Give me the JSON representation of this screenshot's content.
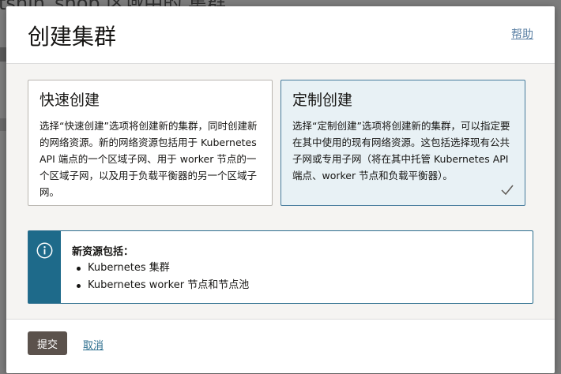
{
  "background": {
    "page_text": "tshin_shop 区域中的 集群"
  },
  "dialog": {
    "title": "创建集群",
    "help_label": "帮助"
  },
  "options": [
    {
      "title": "快速创建",
      "description": "选择“快速创建”选项将创建新的集群，同时创建新的网络资源。新的网络资源包括用于 Kubernetes API 端点的一个区域子网、用于 worker 节点的一个区域子网，以及用于负载平衡器的另一个区域子网。",
      "selected": false
    },
    {
      "title": "定制创建",
      "description": "选择“定制创建”选项将创建新的集群，可以指定要在其中使用的现有网络资源。这包括选择现有公共子网或专用子网（将在其中托管 Kubernetes API 端点、worker 节点和负载平衡器）。",
      "selected": true
    }
  ],
  "info": {
    "icon": "info-icon",
    "title": "新资源包括：",
    "items": [
      "Kubernetes 集群",
      "Kubernetes worker 节点和节点池"
    ]
  },
  "footer": {
    "submit_label": "提交",
    "cancel_label": "取消"
  },
  "colors": {
    "selected_card_bg": "#e8f1f5",
    "accent": "#1e6a8a",
    "submit_bg": "#5b524c"
  }
}
